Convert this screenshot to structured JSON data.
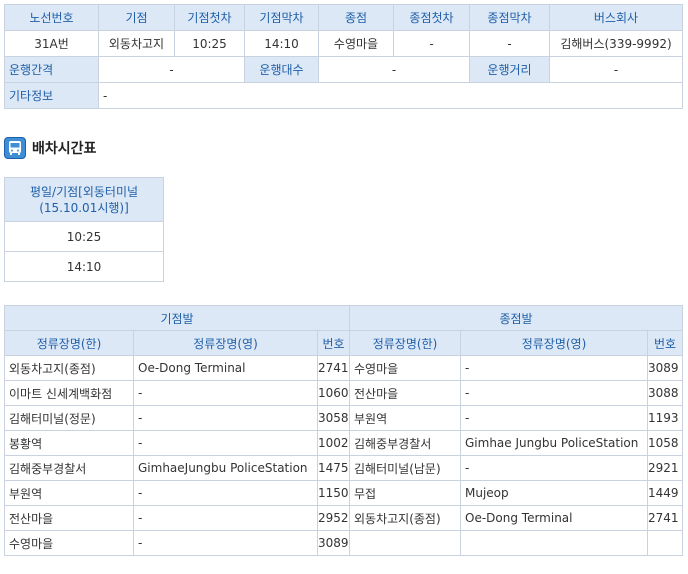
{
  "route_info": {
    "headers": [
      "노선번호",
      "기점",
      "기점첫차",
      "기점막차",
      "종점",
      "종점첫차",
      "종점막차",
      "버스회사"
    ],
    "values": [
      "31A번",
      "외동차고지",
      "10:25",
      "14:10",
      "수영마을",
      "-",
      "-",
      "김해버스(339-9992)"
    ],
    "interval_label": "운행간격",
    "interval_value": "-",
    "count_label": "운행대수",
    "count_value": "-",
    "distance_label": "운행거리",
    "distance_value": "-",
    "etc_label": "기타정보",
    "etc_value": "-"
  },
  "section": {
    "icon": "bus-icon",
    "title": "배차시간표"
  },
  "dispatch": {
    "header_line1": "평일/기점[외동터미널",
    "header_line2": "(15.10.01시행)]",
    "times": [
      "10:25",
      "14:10"
    ]
  },
  "stops": {
    "origin_label": "기점발",
    "dest_label": "종점발",
    "col_kr": "정류장명(한)",
    "col_en": "정류장명(영)",
    "col_no": "번호",
    "origin_rows": [
      {
        "kr": "외동차고지(종점)",
        "en": "Oe-Dong Terminal",
        "no": "2741"
      },
      {
        "kr": "이마트 신세계백화점",
        "en": "-",
        "no": "1060"
      },
      {
        "kr": "김해터미널(정문)",
        "en": "-",
        "no": "3058"
      },
      {
        "kr": "봉황역",
        "en": "-",
        "no": "1002"
      },
      {
        "kr": "김해중부경찰서",
        "en": "GimhaeJungbu PoliceStation",
        "no": "1475"
      },
      {
        "kr": "부원역",
        "en": "-",
        "no": "1150"
      },
      {
        "kr": "전산마을",
        "en": "-",
        "no": "2952"
      },
      {
        "kr": "수영마을",
        "en": "-",
        "no": "3089"
      }
    ],
    "dest_rows": [
      {
        "kr": "수영마을",
        "en": "-",
        "no": "3089"
      },
      {
        "kr": "전산마을",
        "en": "-",
        "no": "3088"
      },
      {
        "kr": "부원역",
        "en": "-",
        "no": "1193"
      },
      {
        "kr": "김해중부경찰서",
        "en": "Gimhae Jungbu PoliceStation",
        "no": "1058"
      },
      {
        "kr": "김해터미널(남문)",
        "en": "-",
        "no": "2921"
      },
      {
        "kr": "무접",
        "en": "Mujeop",
        "no": "1449"
      },
      {
        "kr": "외동차고지(종점)",
        "en": "Oe-Dong Terminal",
        "no": "2741"
      }
    ]
  }
}
